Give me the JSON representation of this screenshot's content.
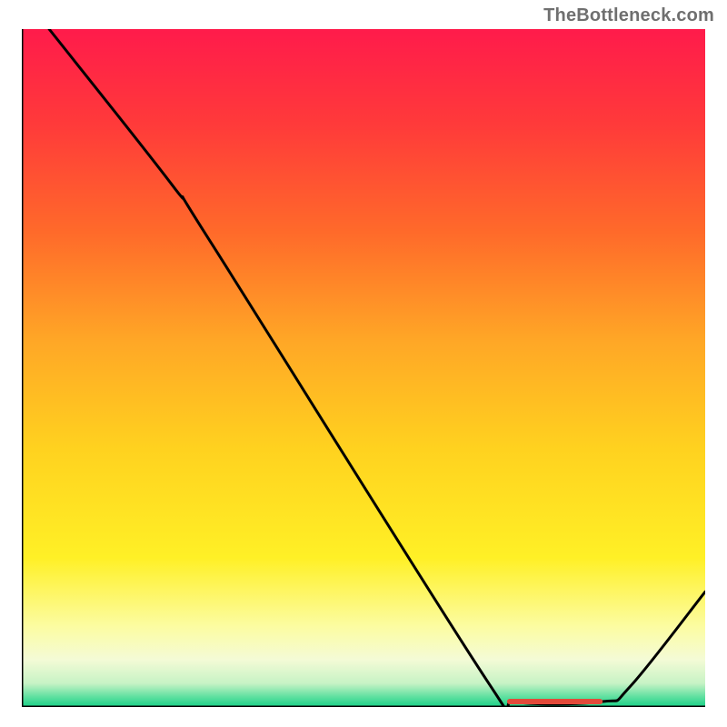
{
  "watermark": "TheBottleneck.com",
  "chart_data": {
    "type": "line",
    "title": "",
    "xlabel": "",
    "ylabel": "",
    "xlim": [
      0,
      100
    ],
    "ylim": [
      0,
      100
    ],
    "grid": false,
    "series": [
      {
        "name": "curve",
        "points": [
          {
            "x": 4,
            "y": 100
          },
          {
            "x": 22,
            "y": 77
          },
          {
            "x": 28,
            "y": 68
          },
          {
            "x": 68,
            "y": 4
          },
          {
            "x": 72,
            "y": 0.8
          },
          {
            "x": 85,
            "y": 0.8
          },
          {
            "x": 89,
            "y": 3
          },
          {
            "x": 100,
            "y": 17
          }
        ]
      }
    ],
    "flat_marker": {
      "x_start": 71,
      "x_end": 85,
      "y": 0.8
    },
    "gradient_stops": [
      {
        "offset": 0.0,
        "color": "#ff1b4b"
      },
      {
        "offset": 0.14,
        "color": "#ff3a3a"
      },
      {
        "offset": 0.3,
        "color": "#ff6a2a"
      },
      {
        "offset": 0.46,
        "color": "#ffa726"
      },
      {
        "offset": 0.62,
        "color": "#ffd21f"
      },
      {
        "offset": 0.78,
        "color": "#fff026"
      },
      {
        "offset": 0.88,
        "color": "#fcfca0"
      },
      {
        "offset": 0.93,
        "color": "#f4fbd6"
      },
      {
        "offset": 0.965,
        "color": "#c7f3c5"
      },
      {
        "offset": 0.985,
        "color": "#5fe0a0"
      },
      {
        "offset": 1.0,
        "color": "#18cf86"
      }
    ]
  }
}
